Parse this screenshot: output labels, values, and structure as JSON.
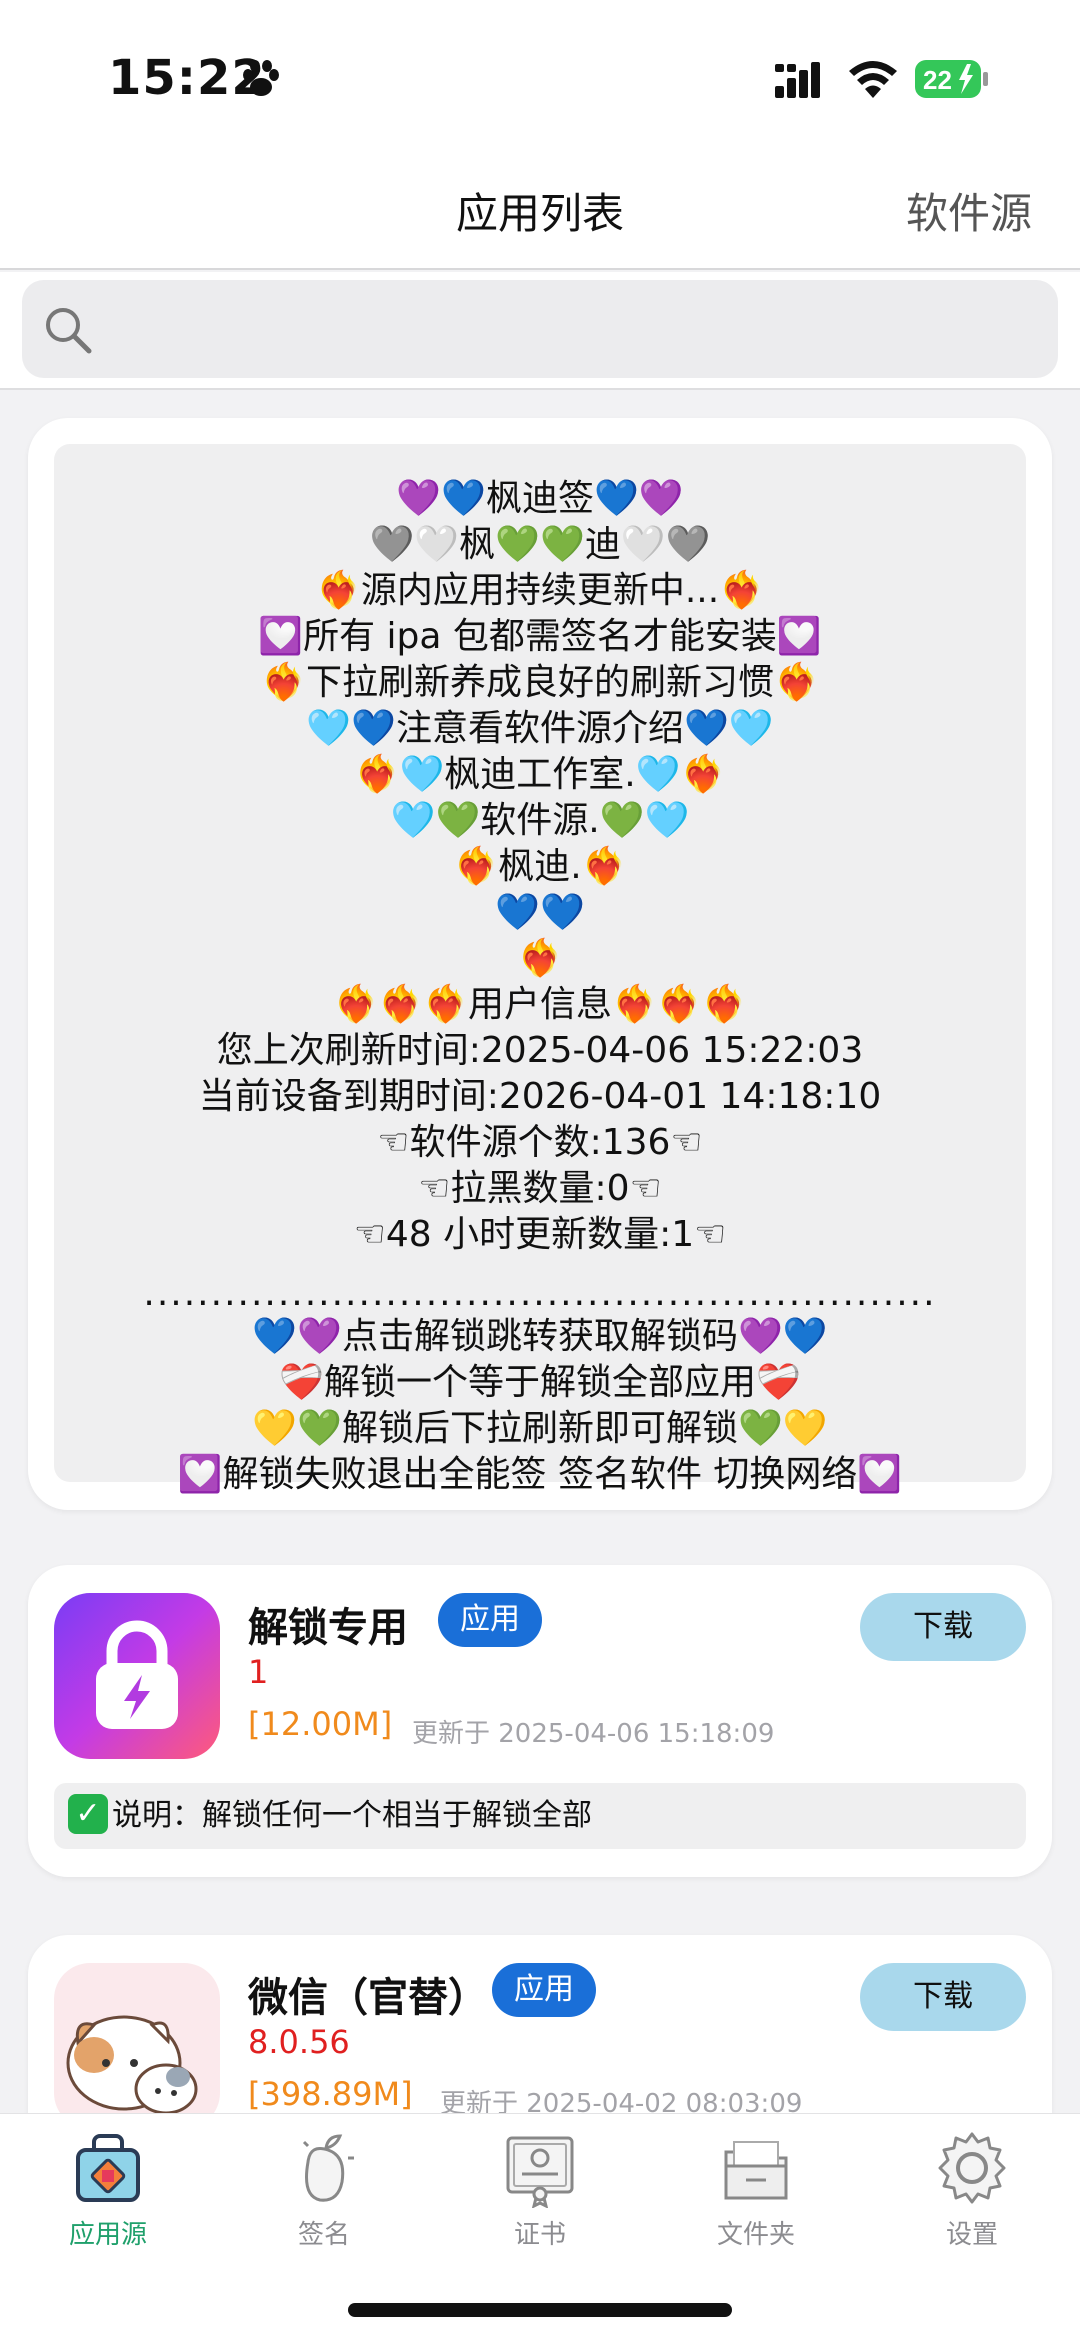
{
  "status_bar": {
    "time": "15:22",
    "battery": "22"
  },
  "nav": {
    "title": "应用列表",
    "right_action": "软件源"
  },
  "search": {
    "placeholder": ""
  },
  "notice": {
    "lines": [
      "💜💙枫迪签💙💜",
      "🩶🤍枫💚💚迪🤍🩶",
      "❤️‍🔥源内应用持续更新中...❤️‍🔥",
      "💟所有 ipa 包都需签名才能安装💟",
      "❤️‍🔥下拉刷新养成良好的刷新习惯❤️‍🔥",
      "🩵💙注意看软件源介绍💙🩵",
      "❤️‍🔥🩵枫迪工作室.🩵❤️‍🔥",
      "🩵💚软件源.💚🩵",
      "❤️‍🔥枫迪.❤️‍🔥",
      "💙💙",
      "❤️‍🔥",
      "❤️‍🔥❤️‍🔥❤️‍🔥用户信息❤️‍🔥❤️‍🔥❤️‍🔥",
      "您上次刷新时间:2025-04-06 15:22:03",
      "当前设备到期时间:2026-04-01 14:18:10",
      "☜软件源个数:136☜",
      "☜拉黑数量:0☜",
      "☜48 小时更新数量:1☜",
      "",
      "...........................................................",
      "💙💜点击解锁跳转获取解锁码💜💙",
      "❤️‍🩹解锁一个等于解锁全部应用❤️‍🩹",
      "💛💚解锁后下拉刷新即可解锁💚💛",
      "💟解锁失败退出全能签 签名软件 切换网络💟"
    ]
  },
  "apps": [
    {
      "name": "解锁专用",
      "tag": "应用",
      "version": "1",
      "size": "[12.00M]",
      "updated": "更新于 2025-04-06 15:18:09",
      "download_label": "下载",
      "desc": "说明：解锁任何一个相当于解锁全部",
      "desc_mark": "✓"
    },
    {
      "name": "微信（官替）",
      "tag": "应用",
      "version": "8.0.56",
      "size": "[398.89M]",
      "updated": "更新于 2025-04-02 08:03:09",
      "download_label": "下载"
    }
  ],
  "tabs": [
    {
      "label": "应用源",
      "icon": "bag-icon",
      "active": true
    },
    {
      "label": "签名",
      "icon": "mango-icon",
      "active": false
    },
    {
      "label": "证书",
      "icon": "certificate-icon",
      "active": false
    },
    {
      "label": "文件夹",
      "icon": "folder-icon",
      "active": false
    },
    {
      "label": "设置",
      "icon": "gear-icon",
      "active": false
    }
  ],
  "colors": {
    "accent": "#1fa06b",
    "tag": "#1a6fd8",
    "download": "#a9d8ec",
    "version": "#e02020",
    "size": "#f08a1c"
  }
}
